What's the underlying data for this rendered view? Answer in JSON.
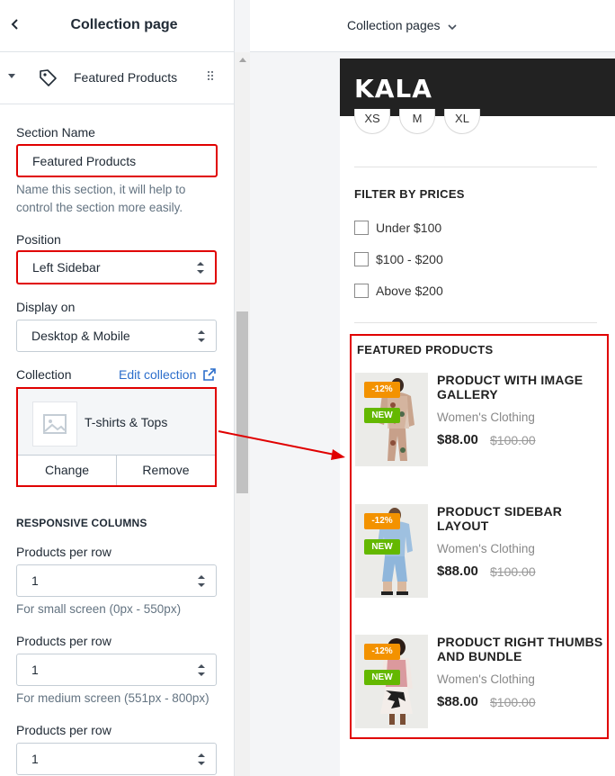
{
  "panel": {
    "title": "Collection page",
    "section_label": "Featured Products",
    "section_name_label": "Section Name",
    "section_name_value": "Featured Products",
    "section_name_hint": "Name this section, it will help to control the section more easily.",
    "position_label": "Position",
    "position_value": "Left Sidebar",
    "display_label": "Display on",
    "display_value": "Desktop & Mobile",
    "collection_label": "Collection",
    "edit_collection": "Edit collection",
    "collection_name": "T-shirts & Tops",
    "change_label": "Change",
    "remove_label": "Remove",
    "responsive_heading": "RESPONSIVE COLUMNS",
    "per_row": [
      {
        "label": "Products per row",
        "value": "1",
        "hint": "For small screen (0px - 550px)"
      },
      {
        "label": "Products per row",
        "value": "1",
        "hint": "For medium screen (551px - 800px)"
      },
      {
        "label": "Products per row",
        "value": "1",
        "hint": ""
      }
    ]
  },
  "topbar": {
    "page_selector": "Collection pages"
  },
  "preview": {
    "logo": "KALA",
    "sizes": [
      "XS",
      "M",
      "XL"
    ],
    "filter_title": "FILTER BY PRICES",
    "price_filters": [
      "Under $100",
      "$100 - $200",
      "Above $200"
    ],
    "featured_title": "FEATURED PRODUCTS",
    "products": [
      {
        "name": "PRODUCT WITH IMAGE GALLERY",
        "category": "Women's Clothing",
        "price": "$88.00",
        "old_price": "$100.00",
        "sale": "-12%",
        "new": "NEW"
      },
      {
        "name": "PRODUCT SIDEBAR LAYOUT",
        "category": "Women's Clothing",
        "price": "$88.00",
        "old_price": "$100.00",
        "sale": "-12%",
        "new": "NEW"
      },
      {
        "name": "PRODUCT RIGHT THUMBS AND BUNDLE",
        "category": "Women's Clothing",
        "price": "$88.00",
        "old_price": "$100.00",
        "sale": "-12%",
        "new": "NEW"
      }
    ]
  },
  "colors": {
    "highlight": "#e00000",
    "link": "#2c6ecb",
    "sale_badge": "#f39200",
    "new_badge": "#64b800",
    "header_bg": "#222222"
  }
}
